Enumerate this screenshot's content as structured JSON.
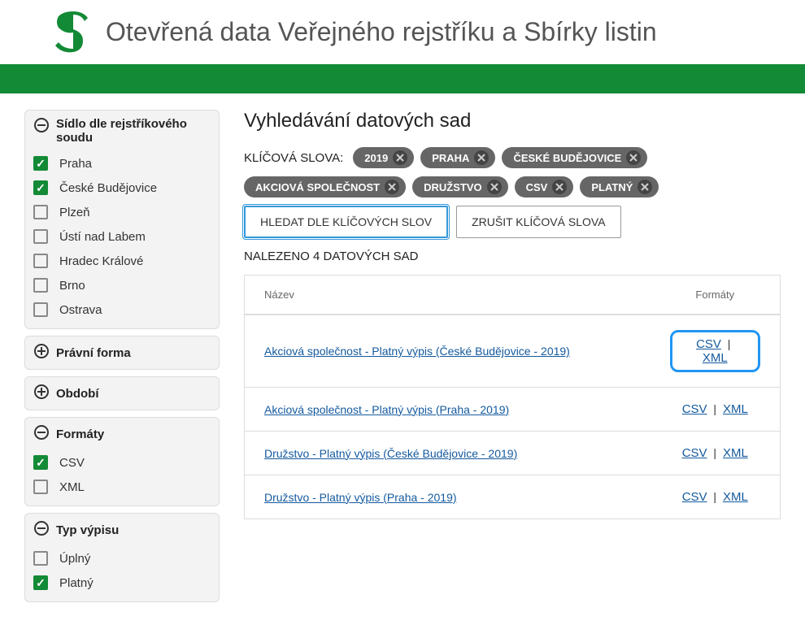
{
  "header": {
    "title": "Otevřená data Veřejného rejstříku a Sbírky listin"
  },
  "sidebar": {
    "sections": [
      {
        "title": "Sídlo dle rejstříkového soudu",
        "expanded": true,
        "items": [
          {
            "label": "Praha",
            "checked": true
          },
          {
            "label": "České Budějovice",
            "checked": true
          },
          {
            "label": "Plzeň",
            "checked": false
          },
          {
            "label": "Ústí nad Labem",
            "checked": false
          },
          {
            "label": "Hradec Králové",
            "checked": false
          },
          {
            "label": "Brno",
            "checked": false
          },
          {
            "label": "Ostrava",
            "checked": false
          }
        ]
      },
      {
        "title": "Právní forma",
        "expanded": false,
        "items": []
      },
      {
        "title": "Období",
        "expanded": false,
        "items": []
      },
      {
        "title": "Formáty",
        "expanded": true,
        "items": [
          {
            "label": "CSV",
            "checked": true
          },
          {
            "label": "XML",
            "checked": false
          }
        ]
      },
      {
        "title": "Typ výpisu",
        "expanded": true,
        "items": [
          {
            "label": "Úplný",
            "checked": false
          },
          {
            "label": "Platný",
            "checked": true
          }
        ]
      }
    ]
  },
  "content": {
    "title": "Vyhledávání datových sad",
    "keywords_label": "KLÍČOVÁ SLOVA:",
    "chips": [
      {
        "label": "2019"
      },
      {
        "label": "PRAHA"
      },
      {
        "label": "ČESKÉ BUDĚJOVICE"
      },
      {
        "label": "AKCIOVÁ SPOLEČNOST"
      },
      {
        "label": "DRUŽSTVO"
      },
      {
        "label": "CSV"
      },
      {
        "label": "PLATNÝ"
      }
    ],
    "buttons": {
      "search": "HLEDAT DLE KLÍČOVÝCH SLOV",
      "clear": "ZRUŠIT KLÍČOVÁ SLOVA"
    },
    "result_count": "NALEZENO 4 DATOVÝCH SAD",
    "table": {
      "headers": {
        "name": "Název",
        "formats": "Formáty"
      },
      "format_labels": {
        "csv": "CSV",
        "xml": "XML"
      },
      "rows": [
        {
          "name": "Akciová společnost - Platný výpis (České Budějovice - 2019)",
          "highlighted": true
        },
        {
          "name": "Akciová společnost - Platný výpis (Praha - 2019)",
          "highlighted": false
        },
        {
          "name": "Družstvo - Platný výpis (České Budějovice - 2019)",
          "highlighted": false
        },
        {
          "name": "Družstvo - Platný výpis (Praha - 2019)",
          "highlighted": false
        }
      ]
    }
  }
}
